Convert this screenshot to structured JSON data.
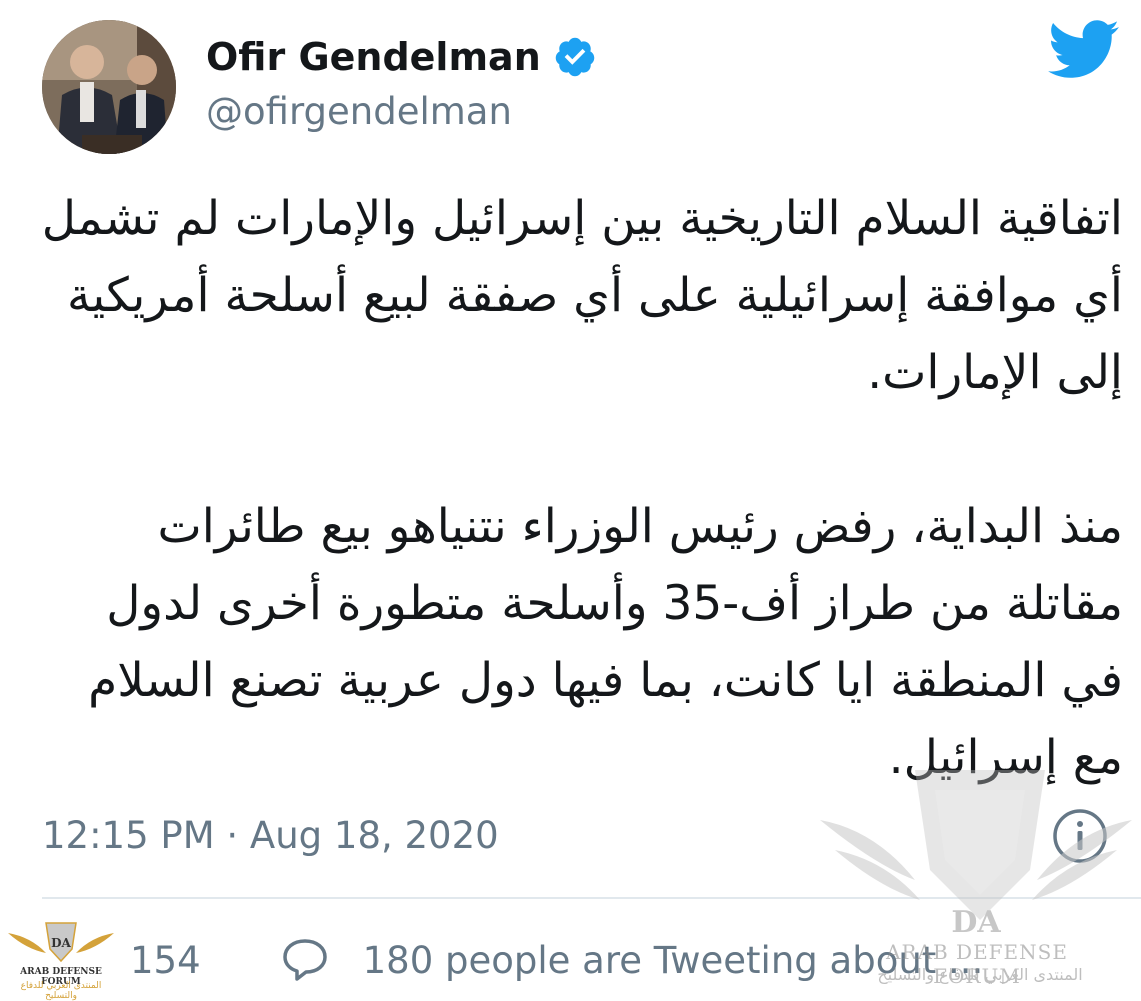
{
  "user": {
    "display_name": "Ofir Gendelman",
    "handle": "@ofirgendelman",
    "verified": true,
    "avatar_icon": "profile-photo"
  },
  "tweet": {
    "paragraph_1": "اتفاقية السلام التاريخية بين إسرائيل والإمارات لم تشمل أي موافقة إسرائيلية على أي صفقة لبيع أسلحة أمريكية إلى الإمارات.",
    "paragraph_2": "منذ البداية، رفض رئيس الوزراء نتنياهو بيع طائرات مقاتلة من طراز أف-35 وأسلحة متطورة أخرى لدول في المنطقة ايا كانت، بما فيها دول عربية تصنع السلام مع إسرائيل."
  },
  "meta": {
    "timestamp": "12:15 PM · Aug 18, 2020"
  },
  "actions": {
    "like_count": "154",
    "tweeting_text": "180 people are Tweeting about ..."
  },
  "watermark": {
    "logo_letters": "DA",
    "name_en": "ARAB DEFENSE FORUM",
    "name_ar": "المنتدى العربي للدفاع والتسليح"
  },
  "corner_logo": {
    "name_en": "ARAB DEFENSE FORUM",
    "name_ar": "المنتدى العربي للدفاع والتسليح"
  },
  "colors": {
    "accent": "#1da1f2",
    "text_primary": "#14171a",
    "text_secondary": "#657786",
    "divider": "#e1e8ed"
  }
}
